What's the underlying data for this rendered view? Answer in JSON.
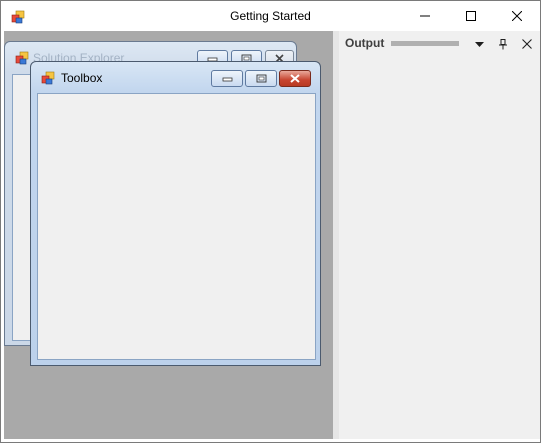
{
  "window": {
    "title": "Getting Started",
    "icon": "app-windows-icon"
  },
  "mdi_children": [
    {
      "title": "Solution Explorer",
      "state": "inactive"
    },
    {
      "title": "Toolbox",
      "state": "active"
    }
  ],
  "output_panel": {
    "title": "Output"
  },
  "colors": {
    "mdi_background": "#a9a9a9",
    "panel_background": "#f0f0f0",
    "active_caption": "#c2d6ee",
    "close_button": "#c7442f"
  }
}
